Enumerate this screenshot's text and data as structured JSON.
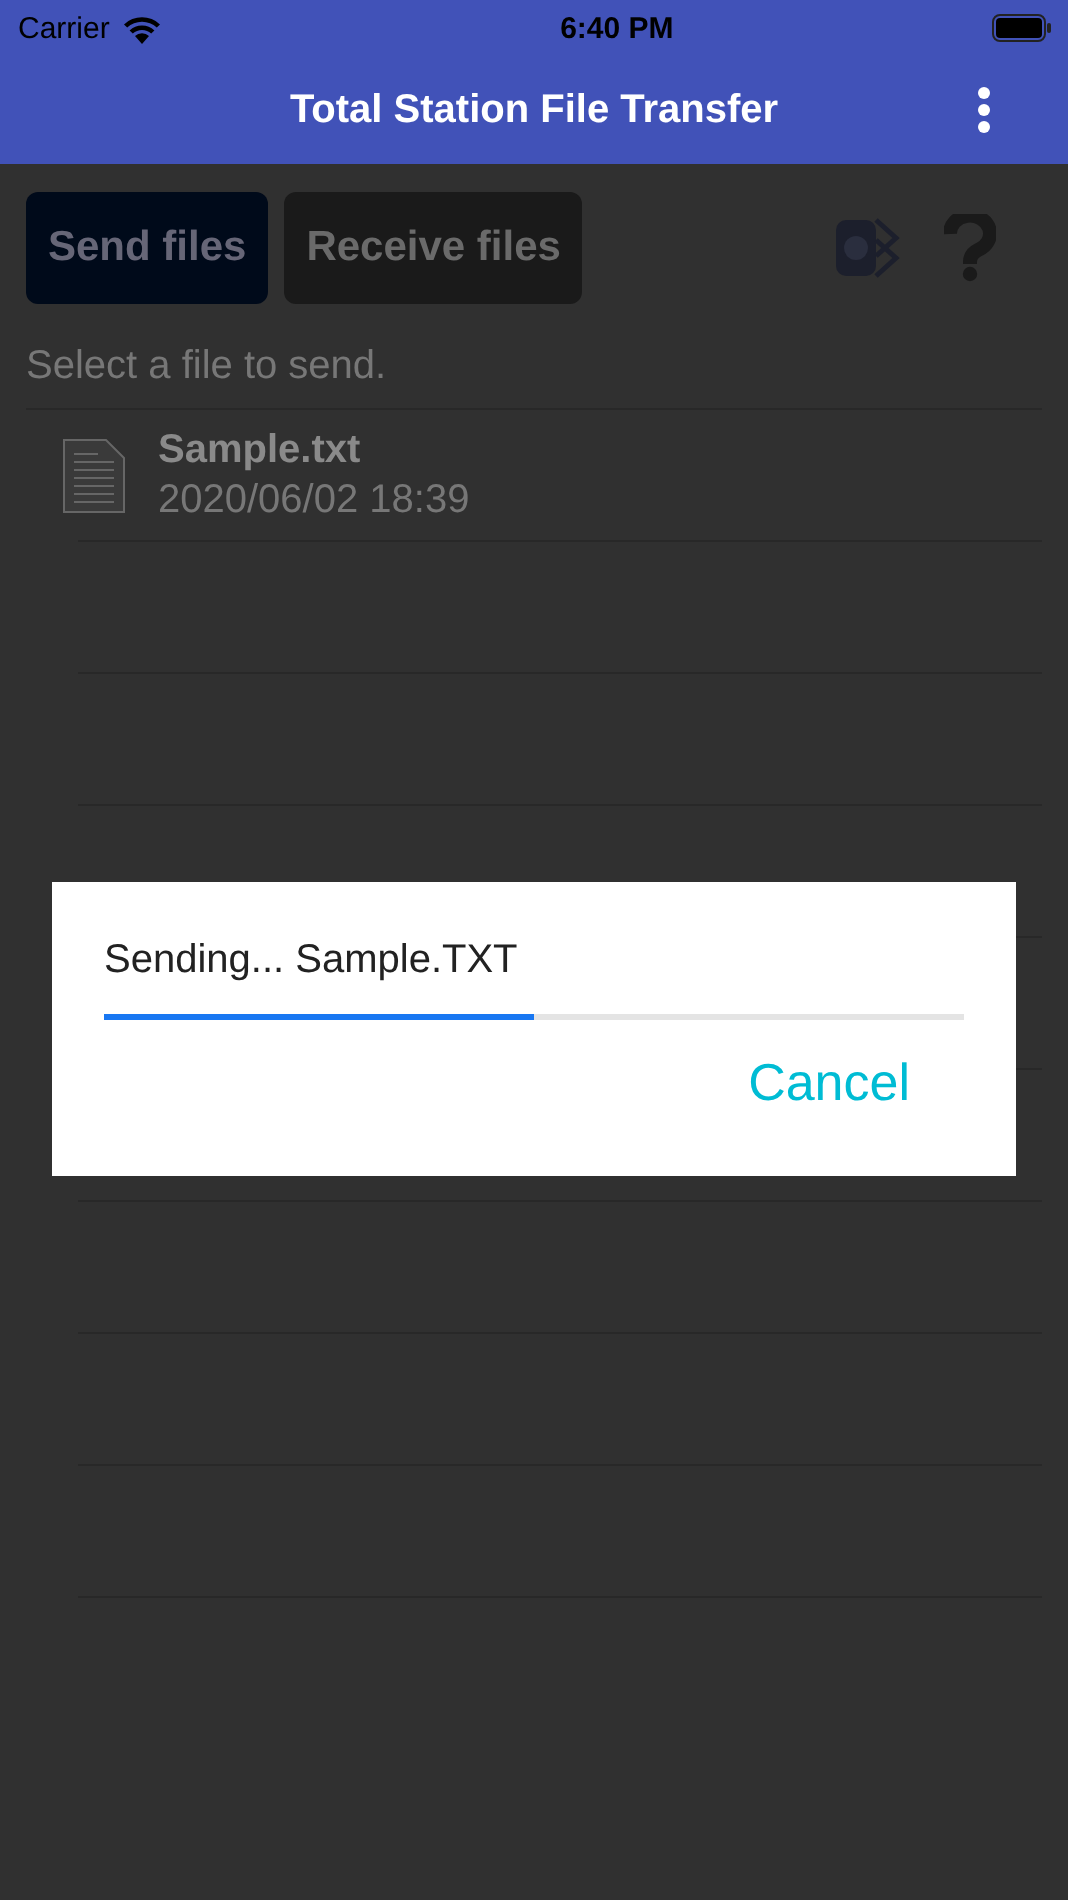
{
  "status_bar": {
    "carrier": "Carrier",
    "time": "6:40 PM"
  },
  "app_bar": {
    "title": "Total Station File Transfer"
  },
  "mode_buttons": [
    {
      "label": "Send files",
      "selected": true
    },
    {
      "label": "Receive files",
      "selected": false
    }
  ],
  "hint": "Select a file to send.",
  "files": [
    {
      "name": "Sample.txt",
      "date": "2020/06/02 18:39"
    }
  ],
  "dialog": {
    "message": "Sending... Sample.TXT",
    "progress": {
      "level": 0.5
    },
    "button": "Cancel"
  }
}
